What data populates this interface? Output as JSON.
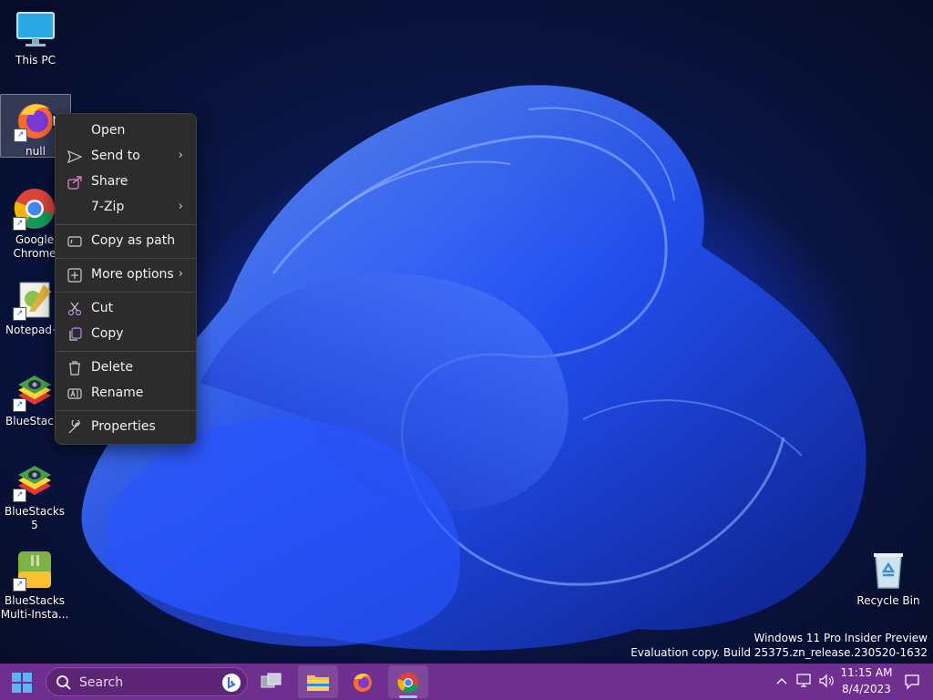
{
  "desktop": {
    "icons": [
      {
        "label": "This PC",
        "icon": "monitor-icon"
      },
      {
        "label": "null",
        "icon": "firefox-icon"
      },
      {
        "label": "Google Chrome",
        "icon": "chrome-icon"
      },
      {
        "label": "Notepad+",
        "icon": "notepad-plus-plus-icon"
      },
      {
        "label": "BlueStacks",
        "icon": "bluestacks-icon"
      },
      {
        "label": "BlueStacks 5",
        "icon": "bluestacks-icon"
      },
      {
        "label": "BlueStacks Multi-Insta...",
        "icon": "bluestacks-multi-instance-icon"
      },
      {
        "label": "Recycle Bin",
        "icon": "recycle-bin-icon"
      }
    ]
  },
  "context_menu": {
    "items": [
      {
        "label": "Open",
        "icon": ""
      },
      {
        "label": "Send to",
        "icon": "send-icon",
        "submenu": true
      },
      {
        "label": "Share",
        "icon": "share-icon"
      },
      {
        "label": "7-Zip",
        "icon": "",
        "submenu": true
      },
      {
        "label": "Copy as path",
        "icon": "copy-path-icon"
      },
      {
        "label": "More options",
        "icon": "more-options-icon",
        "submenu": true
      },
      {
        "label": "Cut",
        "icon": "scissors-icon"
      },
      {
        "label": "Copy",
        "icon": "copy-icon"
      },
      {
        "label": "Delete",
        "icon": "trash-icon"
      },
      {
        "label": "Rename",
        "icon": "rename-icon"
      },
      {
        "label": "Properties",
        "icon": "wrench-icon"
      }
    ]
  },
  "watermark": {
    "line1": "Windows 11 Pro Insider Preview",
    "line2": "Evaluation copy. Build 25375.zn_release.230520-1632"
  },
  "taskbar": {
    "search_placeholder": "Search",
    "clock": {
      "time": "11:15 AM",
      "date": "8/4/2023"
    },
    "accent": "#6f2f8e"
  }
}
